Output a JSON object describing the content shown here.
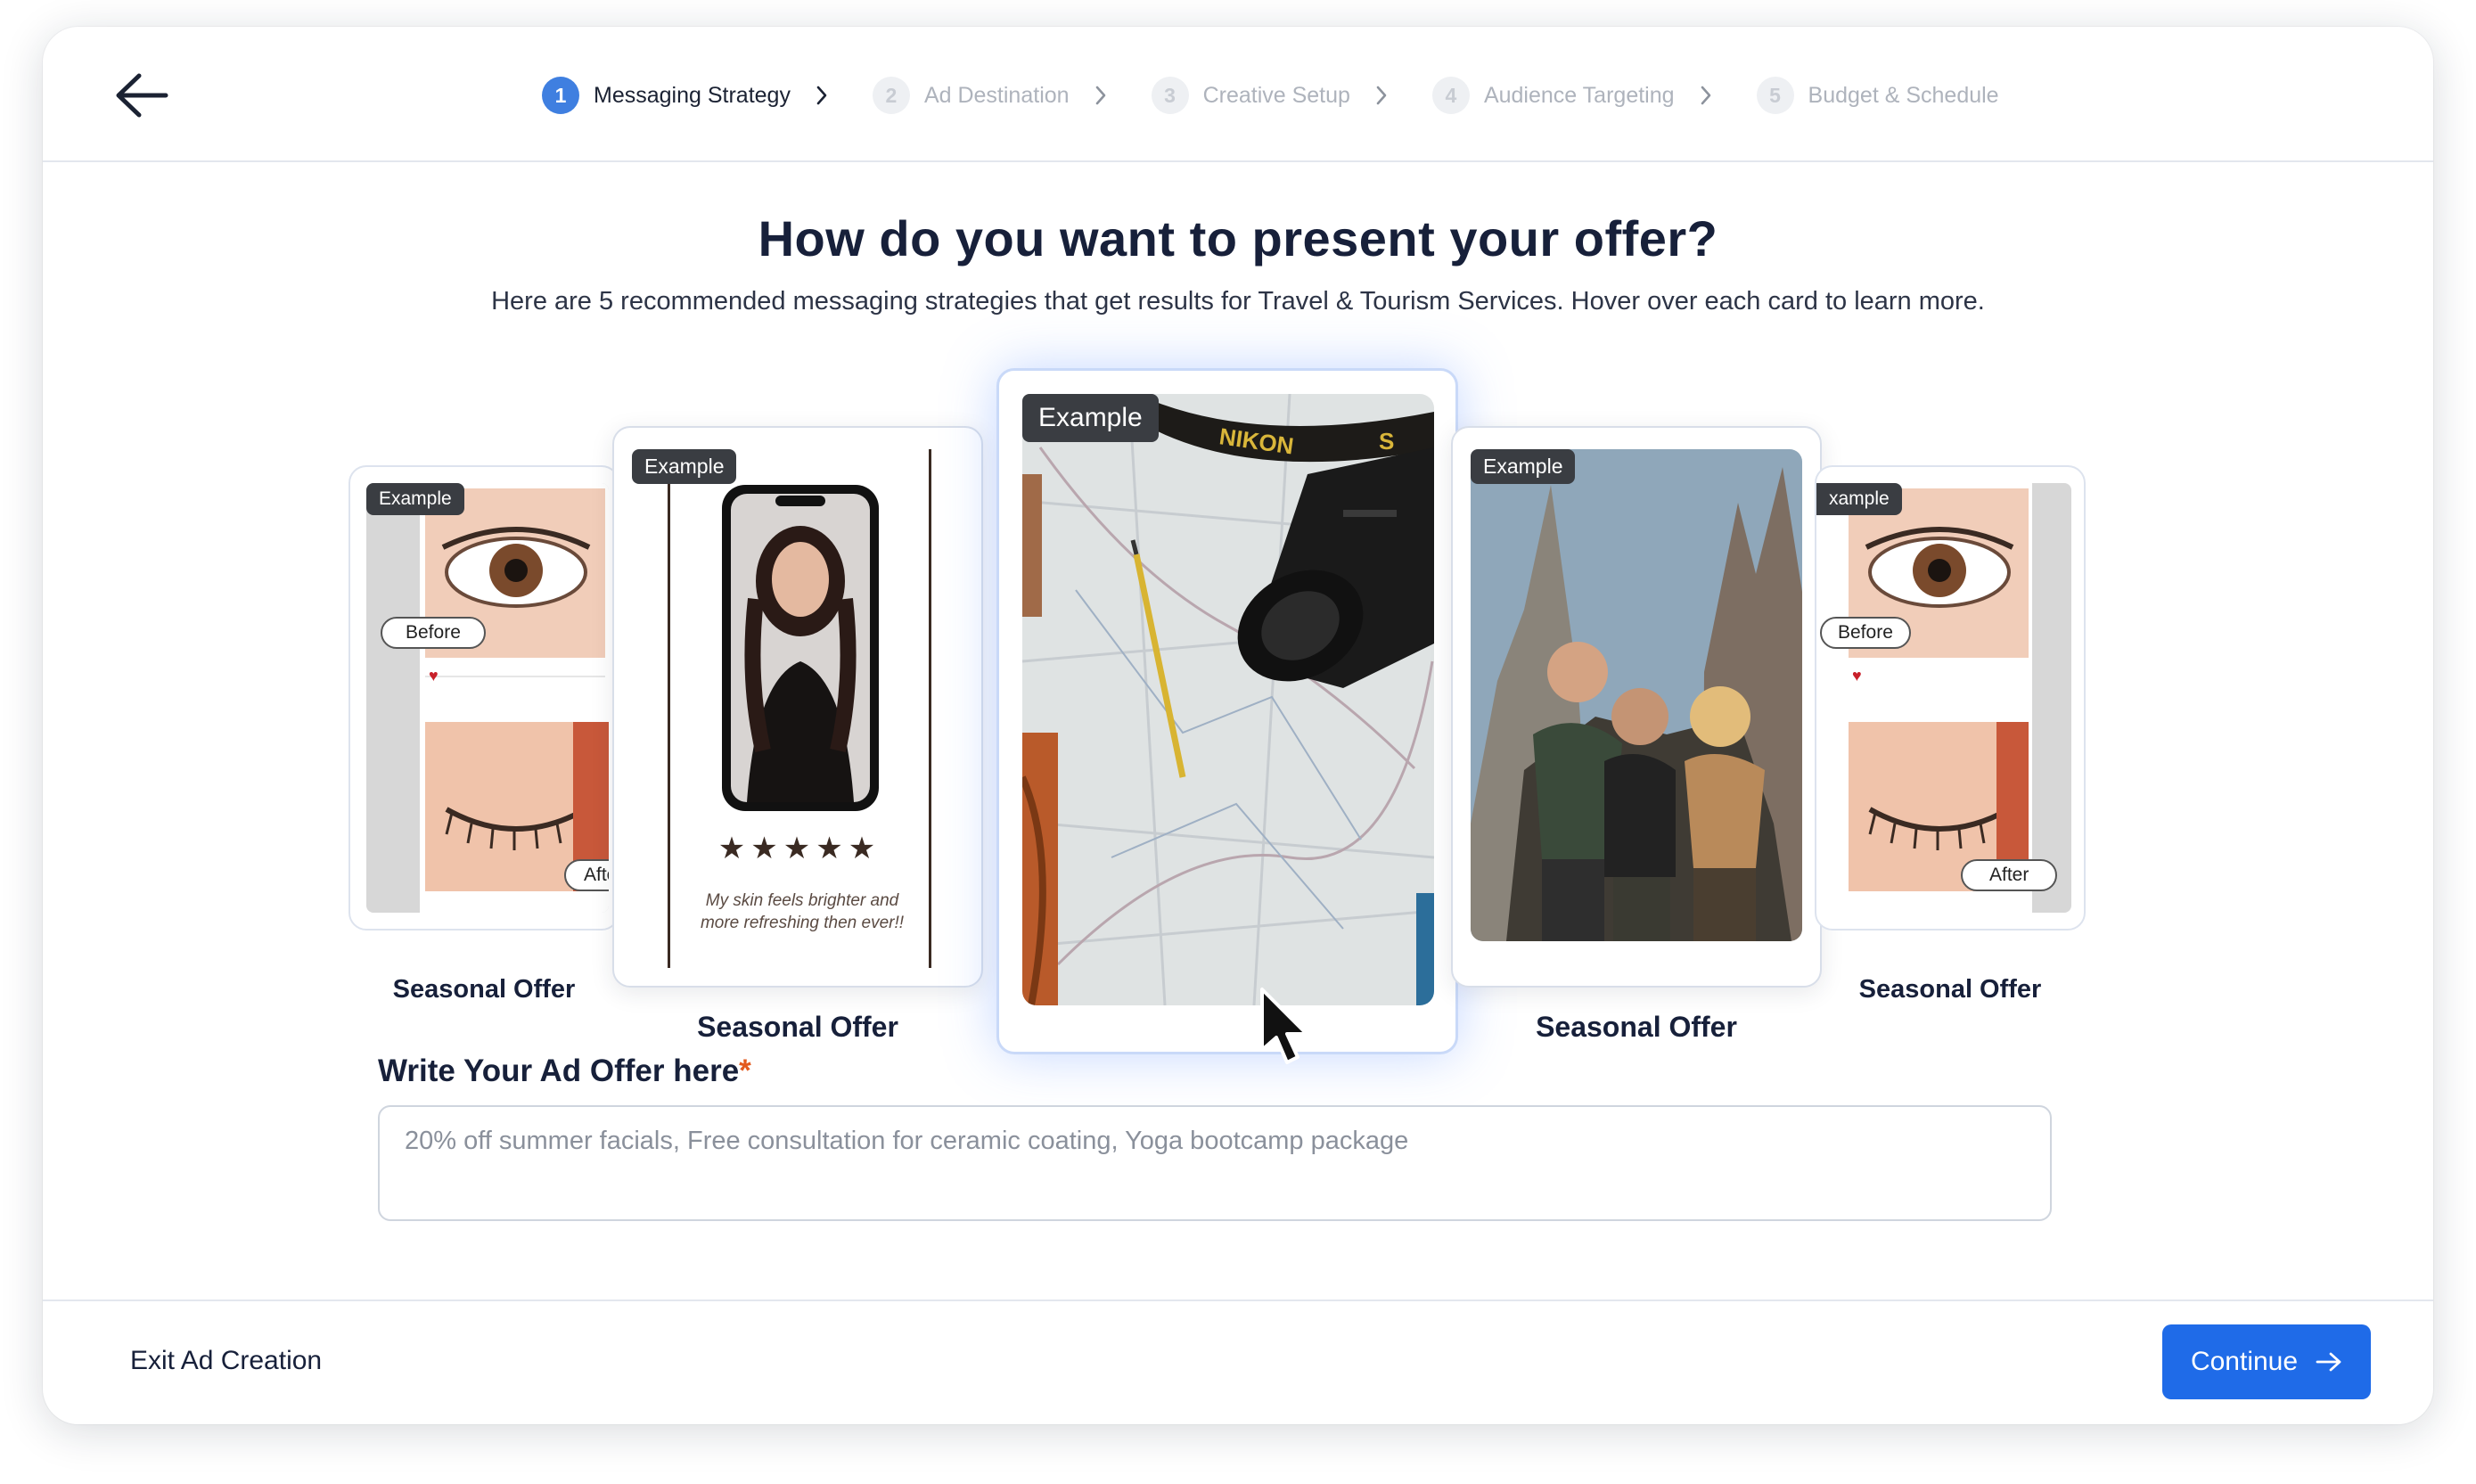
{
  "header": {
    "back_icon": "arrow-left-icon",
    "steps": [
      {
        "num": "1",
        "label": "Messaging Strategy",
        "active": true
      },
      {
        "num": "2",
        "label": "Ad Destination",
        "active": false
      },
      {
        "num": "3",
        "label": "Creative Setup",
        "active": false
      },
      {
        "num": "4",
        "label": "Audience Targeting",
        "active": false
      },
      {
        "num": "5",
        "label": "Budget & Schedule",
        "active": false
      }
    ]
  },
  "main": {
    "title": "How do you want to present your offer?",
    "subtitle": "Here are 5 recommended messaging strategies that get results for Travel & Tourism Services. Hover over each card to learn more.",
    "cards": [
      {
        "badge": "Example",
        "label": "Seasonal Offer",
        "before": "Before",
        "after": "After"
      },
      {
        "badge": "Example",
        "label": "Seasonal Offer",
        "testimonial": "My skin feels brighter and more refreshing then ever!!",
        "stars": "★★★★★"
      },
      {
        "badge": "Example",
        "label": ""
      },
      {
        "badge": "Example",
        "label": "Seasonal Offer"
      },
      {
        "badge": "xample",
        "label": "Seasonal Offer",
        "before": "Before",
        "after": "After"
      }
    ]
  },
  "form": {
    "label": "Write Your Ad Offer here",
    "required_mark": "*",
    "value": "",
    "placeholder": "20% off summer facials, Free consultation for ceramic coating, Yoga bootcamp package"
  },
  "footer": {
    "exit_label": "Exit Ad Creation",
    "continue_label": "Continue"
  },
  "colors": {
    "primary": "#1f6be8",
    "step_active": "#3f7fe0",
    "required": "#e35a1f"
  }
}
